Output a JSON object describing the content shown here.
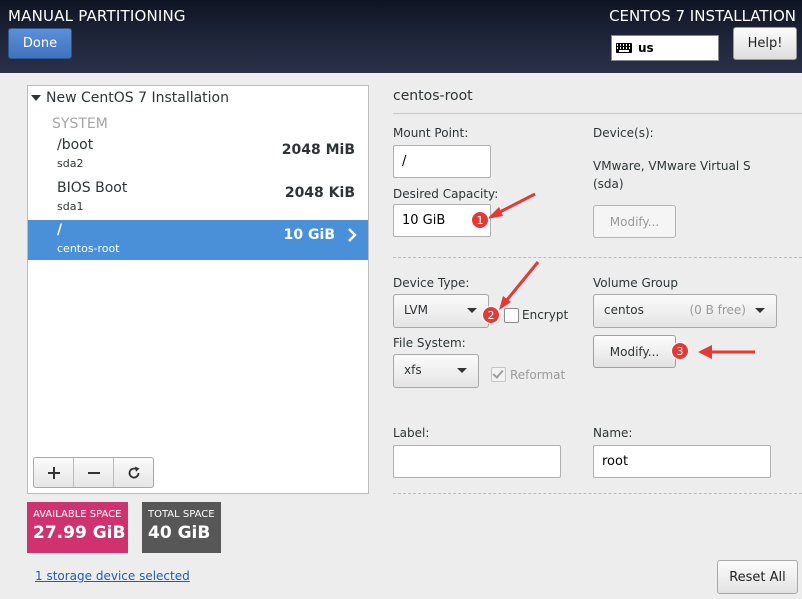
{
  "header": {
    "title": "MANUAL PARTITIONING",
    "done_label": "Done",
    "install_title": "CENTOS 7 INSTALLATION",
    "keyboard_layout": "us",
    "help_label": "Help!"
  },
  "partition_list": {
    "group_title": "New CentOS 7 Installation",
    "system_label": "SYSTEM",
    "mounts": [
      {
        "name": "/boot",
        "device": "sda2",
        "size": "2048 MiB",
        "selected": false
      },
      {
        "name": "BIOS Boot",
        "device": "sda1",
        "size": "2048 KiB",
        "selected": false
      },
      {
        "name": "/",
        "device": "centos-root",
        "size": "10 GiB",
        "selected": true
      }
    ],
    "toolbar": {
      "add_icon": "plus-icon",
      "remove_icon": "minus-icon",
      "refresh_icon": "refresh-icon"
    }
  },
  "space": {
    "available_label": "AVAILABLE SPACE",
    "available_value": "27.99 GiB",
    "total_label": "TOTAL SPACE",
    "total_value": "40 GiB"
  },
  "storage_link": "1 storage device selected",
  "reset_label": "Reset All",
  "detail": {
    "title": "centos-root",
    "mount_point_label": "Mount Point:",
    "mount_point_value": "/",
    "desired_capacity_label": "Desired Capacity:",
    "desired_capacity_value": "10 GiB",
    "devices_label": "Device(s):",
    "devices_line1": "VMware, VMware Virtual S",
    "devices_line2": "(sda)",
    "devices_modify_label": "Modify...",
    "device_type_label": "Device Type:",
    "device_type_value": "LVM",
    "encrypt_label": "Encrypt",
    "volume_group_label": "Volume Group",
    "volume_group_value": "centos",
    "volume_group_free": "(0 B free)",
    "vg_modify_label": "Modify...",
    "file_system_label": "File System:",
    "file_system_value": "xfs",
    "reformat_label": "Reformat",
    "label_label": "Label:",
    "label_value": "",
    "name_label": "Name:",
    "name_value": "root"
  },
  "annotations": {
    "badge1": "1",
    "badge2": "2",
    "badge3": "3",
    "color": "#e53935"
  },
  "colors": {
    "selection": "#4a90d9",
    "available": "#d0326f",
    "total": "#575757",
    "header": "#1d2336"
  }
}
